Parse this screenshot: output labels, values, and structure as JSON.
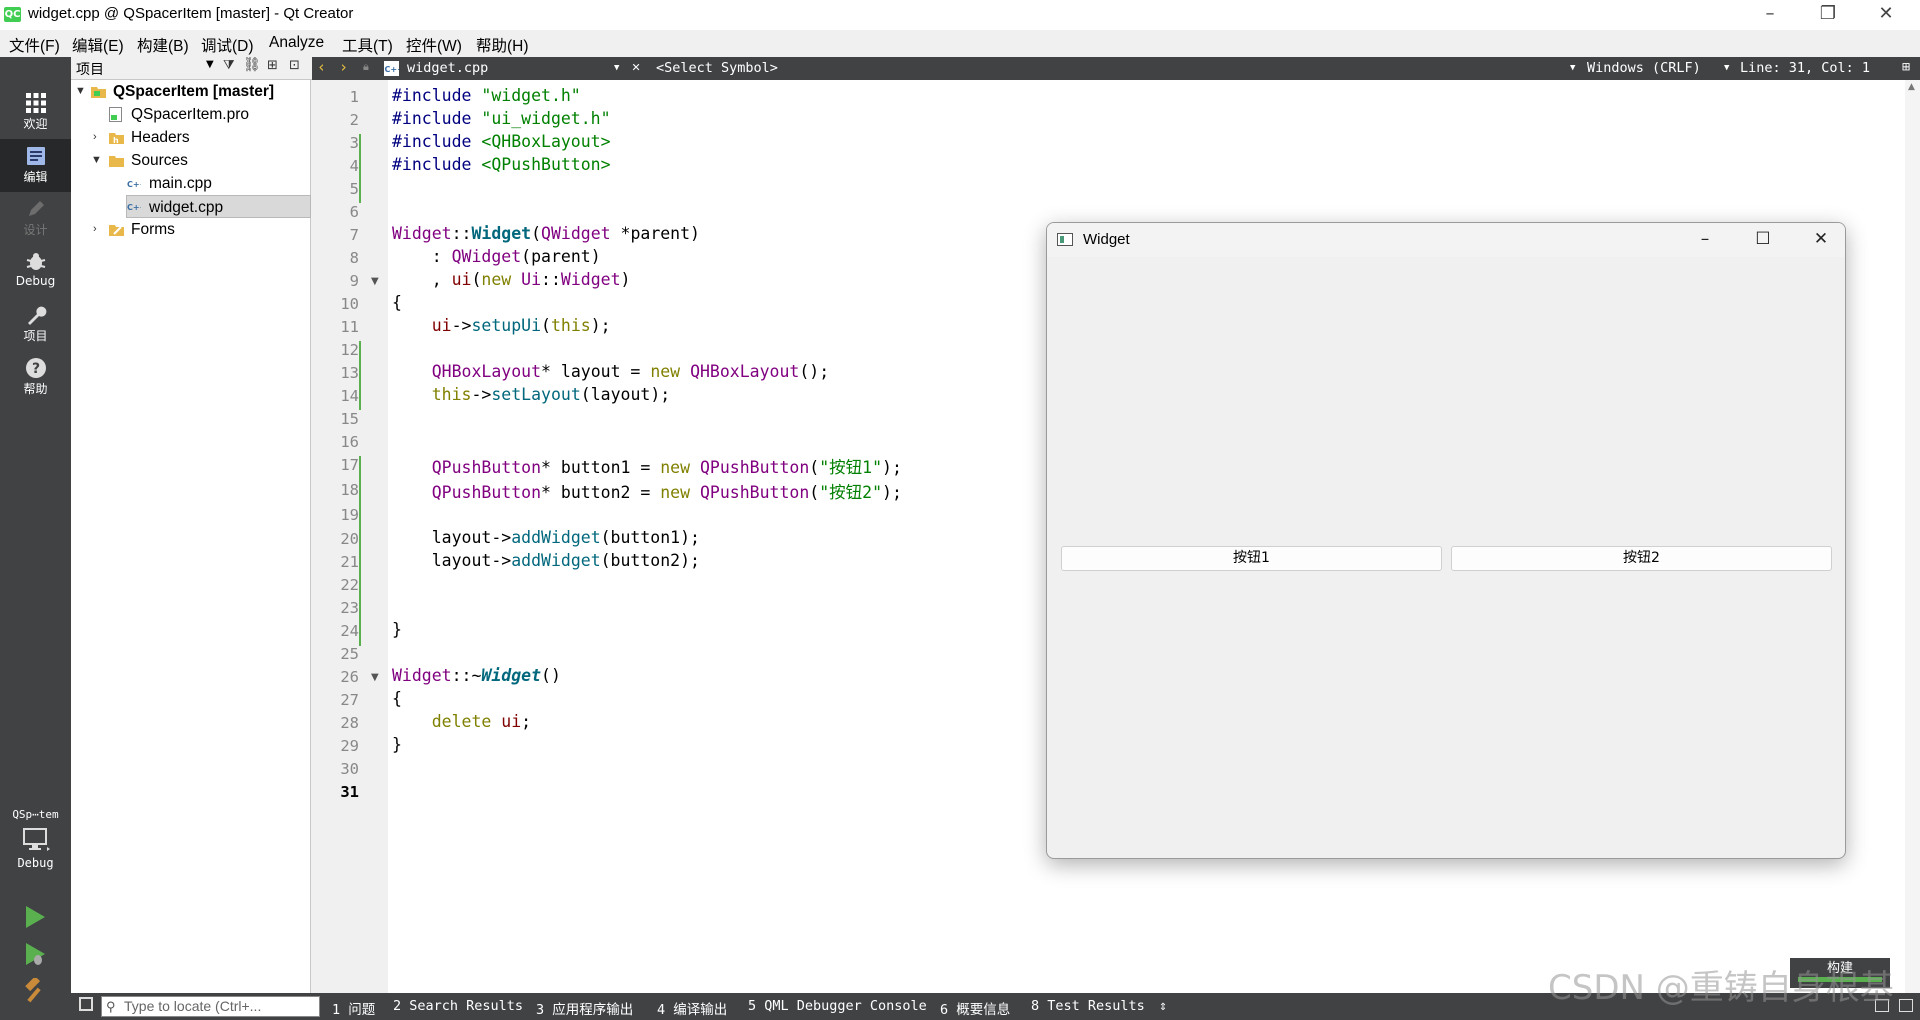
{
  "window": {
    "title": "widget.cpp @ QSpacerItem [master] - Qt Creator",
    "app_icon": "QC"
  },
  "menubar": [
    "文件(F)",
    "编辑(E)",
    "构建(B)",
    "调试(D)",
    "Analyze",
    "工具(T)",
    "控件(W)",
    "帮助(H)"
  ],
  "modes": [
    {
      "label": "欢迎",
      "icon": "grid-icon"
    },
    {
      "label": "编辑",
      "icon": "edit-document-icon"
    },
    {
      "label": "设计",
      "icon": "pencil-icon"
    },
    {
      "label": "Debug",
      "icon": "bug-icon"
    },
    {
      "label": "项目",
      "icon": "wrench-icon"
    },
    {
      "label": "帮助",
      "icon": "help-icon"
    }
  ],
  "kit": {
    "name": "QSp⋯tem",
    "config": "Debug"
  },
  "project_panel": {
    "title": "项目",
    "tree": {
      "root": "QSpacerItem [master]",
      "pro": "QSpacerItem.pro",
      "headers": "Headers",
      "sources": "Sources",
      "main": "main.cpp",
      "widget": "widget.cpp",
      "forms": "Forms"
    }
  },
  "editor_toolbar": {
    "file": "widget.cpp",
    "symbol": "<Select Symbol>",
    "line_endings": "Windows (CRLF)",
    "position": "Line: 31, Col: 1"
  },
  "code": {
    "l1": {
      "a": "#include ",
      "b": "\"widget.h\""
    },
    "l2": {
      "a": "#include ",
      "b": "\"ui_widget.h\""
    },
    "l3": {
      "a": "#include ",
      "b": "<QHBoxLayout>"
    },
    "l4": {
      "a": "#include ",
      "b": "<QPushButton>"
    },
    "l7": {
      "a": "Widget",
      "b": "::",
      "c": "Widget",
      "d": "(",
      "e": "QWidget",
      "f": " *parent)"
    },
    "l8": {
      "a": "    : ",
      "b": "QWidget",
      "c": "(parent)"
    },
    "l9": {
      "a": "    , ",
      "b": "ui",
      "c": "(",
      "d": "new",
      "e": " ",
      "f": "Ui",
      "g": "::",
      "h": "Widget",
      "i": ")"
    },
    "l10": "{",
    "l11": {
      "a": "    ",
      "b": "ui",
      "c": "->",
      "d": "setupUi",
      "e": "(",
      "f": "this",
      "g": ");"
    },
    "l13": {
      "a": "    ",
      "b": "QHBoxLayout",
      "c": "* layout = ",
      "d": "new",
      "e": " ",
      "f": "QHBoxLayout",
      "g": "();"
    },
    "l14": {
      "a": "    ",
      "b": "this",
      "c": "->",
      "d": "setLayout",
      "e": "(layout);"
    },
    "l17": {
      "a": "    ",
      "b": "QPushButton",
      "c": "* button1 = ",
      "d": "new",
      "e": " ",
      "f": "QPushButton",
      "g": "(",
      "h": "\"按钮1\"",
      "i": ");"
    },
    "l18": {
      "a": "    ",
      "b": "QPushButton",
      "c": "* button2 = ",
      "d": "new",
      "e": " ",
      "f": "QPushButton",
      "g": "(",
      "h": "\"按钮2\"",
      "i": ");"
    },
    "l20": {
      "a": "    layout->",
      "b": "addWidget",
      "c": "(button1);"
    },
    "l21": {
      "a": "    layout->",
      "b": "addWidget",
      "c": "(button2);"
    },
    "l24": "}",
    "l26": {
      "a": "Widget",
      "b": "::~",
      "c": "Widget",
      "d": "()"
    },
    "l27": "{",
    "l28": {
      "a": "    ",
      "b": "delete",
      "c": " ",
      "d": "ui",
      "e": ";"
    },
    "l29": "}"
  },
  "line_numbers": [
    "1",
    "2",
    "3",
    "4",
    "5",
    "6",
    "7",
    "8",
    "9",
    "10",
    "11",
    "12",
    "13",
    "14",
    "15",
    "16",
    "17",
    "18",
    "19",
    "20",
    "21",
    "22",
    "23",
    "24",
    "25",
    "26",
    "27",
    "28",
    "29",
    "30",
    "31"
  ],
  "widget_window": {
    "title": "Widget",
    "button1": "按钮1",
    "button2": "按钮2"
  },
  "build_popup": "构建",
  "locator_placeholder": "Type to locate (Ctrl+...",
  "output_tabs": [
    "1 问题",
    "2 Search Results",
    "3 应用程序输出",
    "4 编译输出",
    "5 QML Debugger Console",
    "6 概要信息",
    "8 Test Results"
  ],
  "watermark": "CSDN @重铸自身根基",
  "colors": {
    "mode_bar": "#404244",
    "accent_green": "#41cd52",
    "change_marker": "#5ab04e"
  }
}
